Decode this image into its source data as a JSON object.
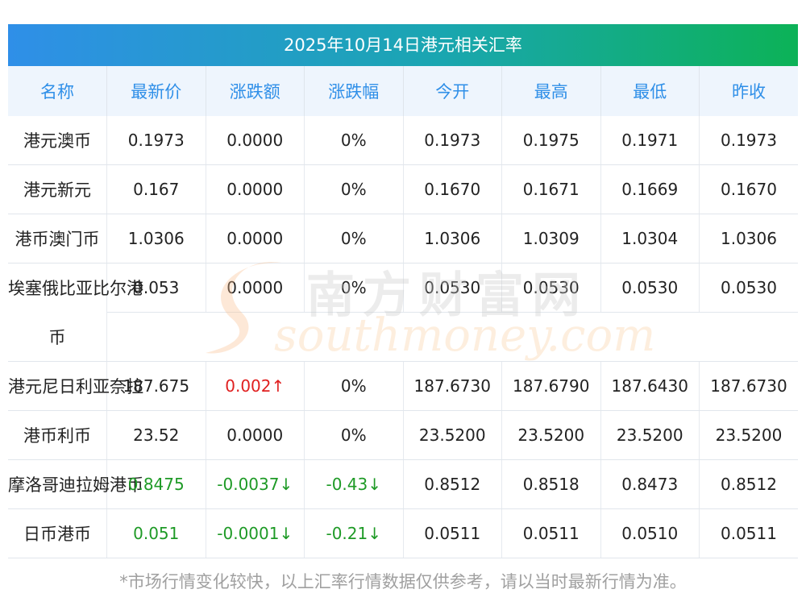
{
  "banner": {
    "title": "2025年10月14日港元相关汇率"
  },
  "headers": [
    "名称",
    "最新价",
    "涨跌额",
    "涨跌幅",
    "今开",
    "最高",
    "最低",
    "昨收"
  ],
  "rows": [
    {
      "name": "港元澳币",
      "latest": "0.1973",
      "change": "0.0000",
      "pct": "0%",
      "open": "0.1973",
      "high": "0.1975",
      "low": "0.1971",
      "prev": "0.1973",
      "dir": "flat"
    },
    {
      "name": "港元新元",
      "latest": "0.167",
      "change": "0.0000",
      "pct": "0%",
      "open": "0.1670",
      "high": "0.1671",
      "low": "0.1669",
      "prev": "0.1670",
      "dir": "flat"
    },
    {
      "name": "港币澳门币",
      "latest": "1.0306",
      "change": "0.0000",
      "pct": "0%",
      "open": "1.0306",
      "high": "1.0309",
      "low": "1.0304",
      "prev": "1.0306",
      "dir": "flat"
    },
    {
      "name": "埃塞俄比亚比尔港",
      "name2": "币",
      "latest": "0.053",
      "change": "0.0000",
      "pct": "0%",
      "open": "0.0530",
      "high": "0.0530",
      "low": "0.0530",
      "prev": "0.0530",
      "dir": "flat"
    },
    {
      "name": "港元尼日利亚奈拉",
      "latest": "187.675",
      "change": "0.002↑",
      "pct": "0%",
      "open": "187.6730",
      "high": "187.6790",
      "low": "187.6430",
      "prev": "187.6730",
      "dir": "up"
    },
    {
      "name": "港币利币",
      "latest": "23.52",
      "change": "0.0000",
      "pct": "0%",
      "open": "23.5200",
      "high": "23.5200",
      "low": "23.5200",
      "prev": "23.5200",
      "dir": "flat"
    },
    {
      "name": "摩洛哥迪拉姆港币",
      "latest": "0.8475",
      "change": "-0.0037↓",
      "pct": "-0.43↓",
      "open": "0.8512",
      "high": "0.8518",
      "low": "0.8473",
      "prev": "0.8512",
      "dir": "down"
    },
    {
      "name": "日币港币",
      "latest": "0.051",
      "change": "-0.0001↓",
      "pct": "-0.21↓",
      "open": "0.0511",
      "high": "0.0511",
      "low": "0.0510",
      "prev": "0.0511",
      "dir": "down"
    }
  ],
  "watermark": {
    "cn": "南方财富网",
    "en": "southmoney.com"
  },
  "footer": {
    "note": "*市场行情变化较快，以上汇率行情数据仅供参考，请以当时最新行情为准。"
  },
  "colors": {
    "up": "#e02020",
    "down": "#1e9a26",
    "header_text": "#2f8fe8"
  }
}
